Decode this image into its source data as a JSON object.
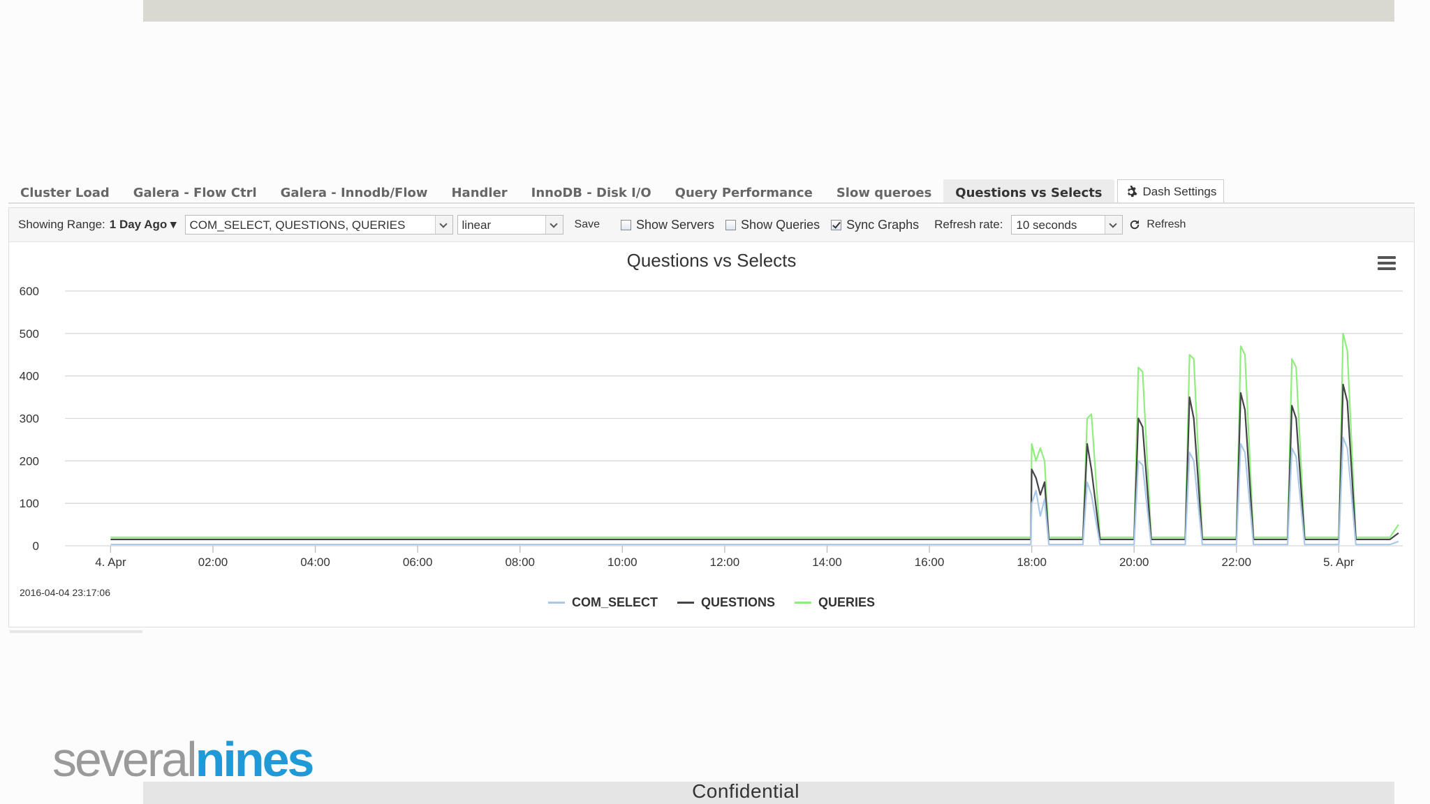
{
  "footer": {
    "confidential": "Confidential"
  },
  "logo": {
    "part1": "several",
    "part2": "nines"
  },
  "tabs": [
    {
      "label": "Cluster Load"
    },
    {
      "label": "Galera - Flow Ctrl"
    },
    {
      "label": "Galera - Innodb/Flow"
    },
    {
      "label": "Handler"
    },
    {
      "label": "InnoDB - Disk I/O"
    },
    {
      "label": "Query Performance"
    },
    {
      "label": "Slow queroes"
    },
    {
      "label": "Questions vs Selects"
    }
  ],
  "dash_settings": {
    "label": "Dash Settings",
    "icon": "gear-icon"
  },
  "toolbar": {
    "range_label": "Showing Range:",
    "range_value": "1 Day Ago ▾",
    "metrics_value": "COM_SELECT, QUESTIONS, QUERIES",
    "scale_value": "linear",
    "save_label": "Save",
    "show_servers": "Show Servers",
    "show_queries": "Show Queries",
    "sync_graphs": "Sync Graphs",
    "refresh_rate_label": "Refresh rate:",
    "refresh_rate_value": "10 seconds",
    "refresh_label": "Refresh"
  },
  "chart": {
    "timestamp": "2016-04-04 23:17:06"
  },
  "chart_data": {
    "type": "line",
    "title": "Questions vs Selects",
    "xlabel": "",
    "ylabel": "",
    "ylim": [
      0,
      600
    ],
    "yticks": [
      "0",
      "100",
      "200",
      "300",
      "400",
      "500",
      "600"
    ],
    "xticks": [
      "4. Apr",
      "02:00",
      "04:00",
      "06:00",
      "08:00",
      "10:00",
      "12:00",
      "14:00",
      "16:00",
      "18:00",
      "20:00",
      "22:00",
      "5. Apr"
    ],
    "grid": true,
    "legend_position": "bottom",
    "x": [
      "4. Apr 00:00",
      "4. Apr 17:59",
      "4. Apr 18:00",
      "4. Apr 18:05",
      "4. Apr 18:10",
      "4. Apr 18:15",
      "4. Apr 18:20",
      "4. Apr 18:30",
      "4. Apr 19:00",
      "4. Apr 19:05",
      "4. Apr 19:10",
      "4. Apr 19:20",
      "4. Apr 20:00",
      "4. Apr 20:05",
      "4. Apr 20:10",
      "4. Apr 20:20",
      "4. Apr 21:00",
      "4. Apr 21:05",
      "4. Apr 21:10",
      "4. Apr 21:20",
      "4. Apr 22:00",
      "4. Apr 22:05",
      "4. Apr 22:10",
      "4. Apr 22:20",
      "4. Apr 23:00",
      "4. Apr 23:05",
      "4. Apr 23:10",
      "4. Apr 23:20",
      "5. Apr 00:00",
      "5. Apr 00:05",
      "5. Apr 00:10",
      "5. Apr 00:20",
      "5. Apr 01:00",
      "5. Apr 01:10"
    ],
    "series": [
      {
        "name": "COM_SELECT",
        "color": "#a9c8e8",
        "values": [
          3,
          3,
          100,
          130,
          70,
          110,
          3,
          3,
          3,
          150,
          120,
          3,
          3,
          200,
          190,
          3,
          3,
          220,
          200,
          3,
          3,
          240,
          220,
          3,
          3,
          230,
          210,
          3,
          3,
          255,
          230,
          3,
          3,
          10
        ]
      },
      {
        "name": "QUESTIONS",
        "color": "#434348",
        "values": [
          15,
          15,
          180,
          160,
          120,
          150,
          15,
          15,
          15,
          240,
          180,
          15,
          15,
          300,
          280,
          15,
          15,
          350,
          300,
          15,
          15,
          360,
          320,
          15,
          15,
          330,
          300,
          15,
          15,
          380,
          340,
          15,
          15,
          30
        ]
      },
      {
        "name": "QUERIES",
        "color": "#90ed7d",
        "values": [
          20,
          20,
          240,
          200,
          230,
          200,
          20,
          20,
          20,
          300,
          310,
          20,
          20,
          420,
          410,
          20,
          20,
          450,
          440,
          20,
          20,
          470,
          450,
          20,
          20,
          440,
          420,
          20,
          20,
          500,
          460,
          20,
          20,
          50
        ]
      }
    ]
  }
}
